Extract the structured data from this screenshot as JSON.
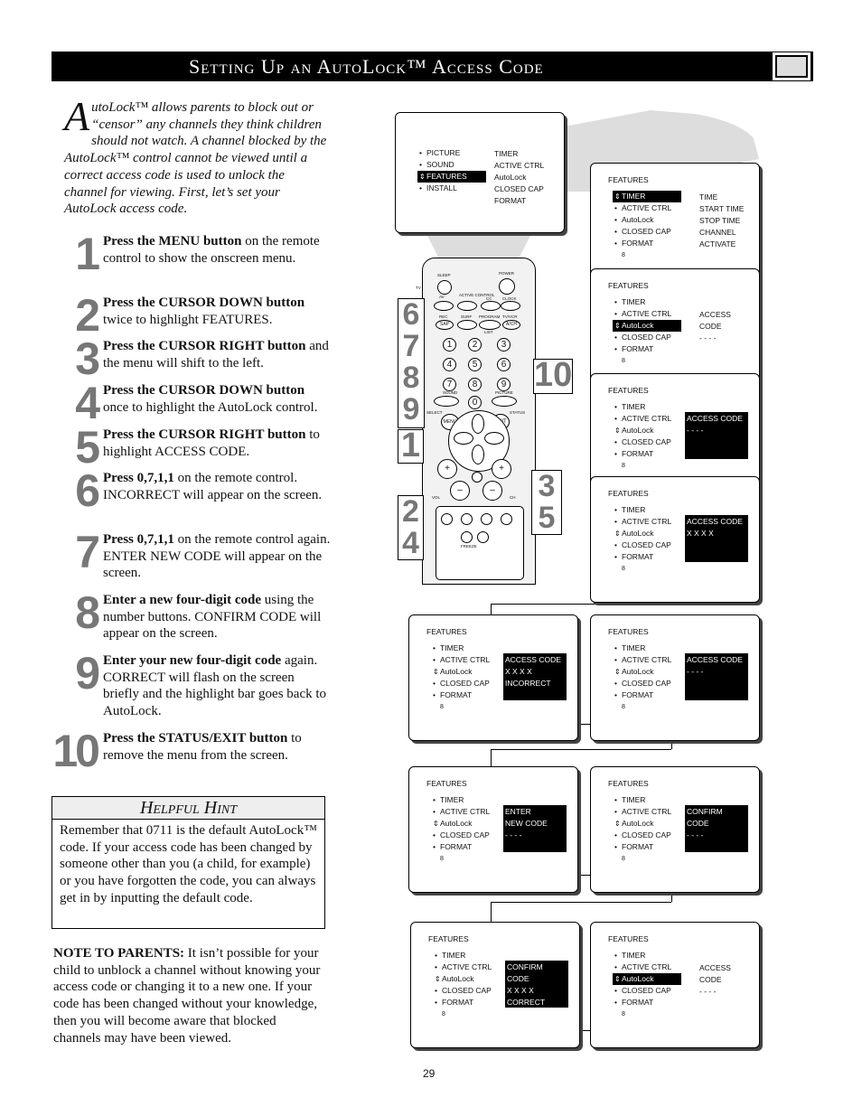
{
  "header": {
    "title": "Setting Up an AutoLock™ Access Code",
    "icon": "hand-pointing-icon"
  },
  "intro": {
    "drop_cap": "A",
    "text": "utoLock™ allows parents to block out or “censor” any channels they think children should not watch.  A channel blocked by the AutoLock™ control cannot be viewed until a correct access code is used to unlock the channel for viewing.  First, let’s set your AutoLock access code."
  },
  "steps": [
    {
      "num": "1",
      "bold": "Press the MENU button",
      "rest": " on the remote control to show the onscreen menu."
    },
    {
      "num": "2",
      "bold": "Press the CURSOR DOWN button",
      "rest": " twice to highlight FEATURES."
    },
    {
      "num": "3",
      "bold": "Press the CURSOR RIGHT button",
      "rest": " and the menu will shift to the left."
    },
    {
      "num": "4",
      "bold": "Press the CURSOR DOWN button",
      "rest": " once to highlight the AutoLock control."
    },
    {
      "num": "5",
      "bold": "Press the CURSOR RIGHT button",
      "rest": " to highlight ACCESS CODE."
    },
    {
      "num": "6",
      "bold": "Press 0,7,1,1",
      "rest": " on the remote control. INCORRECT will appear on the screen."
    },
    {
      "num": "7",
      "bold": "Press 0,7,1,1",
      "rest": " on the remote control again. ENTER NEW CODE will appear on the screen."
    },
    {
      "num": "8",
      "bold": "Enter a new four-digit code",
      "rest": " using the number buttons.  CONFIRM CODE will appear on the screen."
    },
    {
      "num": "9",
      "bold": "Enter your new four-digit code",
      "rest": " again. CORRECT will flash on the screen briefly and the highlight bar goes back to AutoLock."
    },
    {
      "num": "10",
      "bold": "Press the STATUS/EXIT button",
      "rest": " to remove the menu from the screen."
    }
  ],
  "hint": {
    "title": "Helpful Hint",
    "text": "Remember that 0711 is the default AutoLock™ code.  If your access code has been changed by someone other than you (a child, for example) or you have forgotten the code, you can always get in by inputting the default code."
  },
  "note": {
    "bold": "NOTE TO PARENTS:",
    "text": "  It isn’t possible for your child to unblock a channel without knowing your access code or changing it to a new one.  If your code has been changed without your knowledge,  then you will become aware that blocked channels may have been viewed."
  },
  "page_number": "29",
  "callouts": [
    "6\n7\n8\n9",
    "10",
    "1",
    "2\n4",
    "3\n5"
  ],
  "remote": {
    "sleep": "SLEEP",
    "power": "POWER",
    "av": "AV",
    "active": "ACTIVE CONTROL",
    "cc": "CC",
    "clock": "CLOCK",
    "rec": "REC",
    "surf": "SURF",
    "program": "PROGRAM",
    "tvvcr": "TV/VCR",
    "sap": "SAP",
    "ach": "A/CH",
    "list": "LIST",
    "sound": "SOUND",
    "picture": "PICTURE",
    "select": "SELECT",
    "status": "STATUS",
    "menu": "MENU",
    "exit": "EXIT",
    "vol": "VOL",
    "ch": "CH",
    "freeze": "FREEZE",
    "tv": "TV",
    "vcr": "VCR",
    "acc": "ACC",
    "digits": [
      "1",
      "2",
      "3",
      "4",
      "5",
      "6",
      "7",
      "8",
      "9",
      "0"
    ]
  },
  "screens": [
    {
      "heading": "",
      "items": [
        "PICTURE",
        "SOUND",
        "FEATURES",
        "INSTALL"
      ],
      "hl": 2,
      "right": [
        "TIMER",
        "ACTIVE CTRL",
        "AutoLock",
        "CLOSED CAP",
        "FORMAT"
      ],
      "inv": false
    },
    {
      "heading": "FEATURES",
      "items": [
        "TIMER",
        "ACTIVE CTRL",
        "AutoLock",
        "CLOSED CAP",
        "FORMAT",
        "8"
      ],
      "hl": 0,
      "right": [
        "TIME",
        "START TIME",
        "STOP TIME",
        "CHANNEL",
        "ACTIVATE"
      ],
      "inv": false
    },
    {
      "heading": "FEATURES",
      "items": [
        "TIMER",
        "ACTIVE CTRL",
        "AutoLock",
        "CLOSED CAP",
        "FORMAT",
        "8"
      ],
      "hl": 2,
      "right": [
        "ACCESS CODE",
        "- - - -"
      ],
      "inv": false
    },
    {
      "heading": "FEATURES",
      "items": [
        "TIMER",
        "ACTIVE CTRL",
        "AutoLock",
        "CLOSED CAP",
        "FORMAT",
        "8"
      ],
      "sel": 2,
      "right": [
        "ACCESS CODE",
        "- - - -"
      ],
      "inv": true
    },
    {
      "heading": "FEATURES",
      "items": [
        "TIMER",
        "ACTIVE CTRL",
        "AutoLock",
        "CLOSED CAP",
        "FORMAT",
        "8"
      ],
      "sel": 2,
      "right": [
        "ACCESS CODE",
        "X X X X"
      ],
      "inv": true
    },
    {
      "heading": "FEATURES",
      "items": [
        "TIMER",
        "ACTIVE CTRL",
        "AutoLock",
        "CLOSED CAP",
        "FORMAT",
        "8"
      ],
      "sel": 2,
      "right": [
        "ACCESS CODE",
        "X X X X",
        "INCORRECT"
      ],
      "inv": true
    },
    {
      "heading": "FEATURES",
      "items": [
        "TIMER",
        "ACTIVE CTRL",
        "AutoLock",
        "CLOSED CAP",
        "FORMAT",
        "8"
      ],
      "sel": 2,
      "right": [
        "ACCESS CODE",
        "- - - -"
      ],
      "inv": true
    },
    {
      "heading": "FEATURES",
      "items": [
        "TIMER",
        "ACTIVE CTRL",
        "AutoLock",
        "CLOSED CAP",
        "FORMAT",
        "8"
      ],
      "sel": 2,
      "right": [
        "ENTER",
        "NEW CODE",
        "- - - -"
      ],
      "inv": true
    },
    {
      "heading": "FEATURES",
      "items": [
        "TIMER",
        "ACTIVE CTRL",
        "AutoLock",
        "CLOSED CAP",
        "FORMAT",
        "8"
      ],
      "sel": 2,
      "right": [
        "CONFIRM",
        "CODE",
        "- - - -"
      ],
      "inv": true
    },
    {
      "heading": "FEATURES",
      "items": [
        "TIMER",
        "ACTIVE CTRL",
        "AutoLock",
        "CLOSED CAP",
        "FORMAT",
        "8"
      ],
      "sel": 2,
      "right": [
        "CONFIRM",
        "CODE",
        "X X X X",
        "CORRECT"
      ],
      "inv": true
    },
    {
      "heading": "FEATURES",
      "items": [
        "TIMER",
        "ACTIVE CTRL",
        "AutoLock",
        "CLOSED CAP",
        "FORMAT",
        "8"
      ],
      "hl": 2,
      "right": [
        "ACCESS CODE",
        "- - - -"
      ],
      "inv": false
    }
  ]
}
